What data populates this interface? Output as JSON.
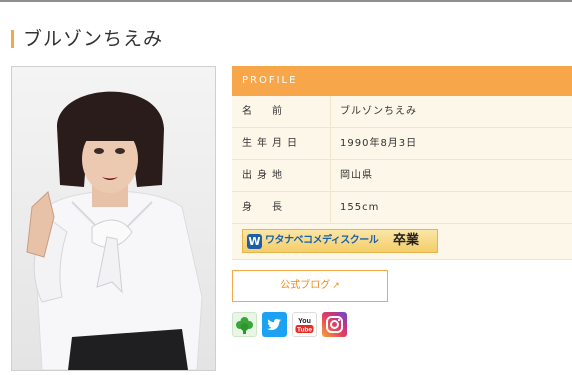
{
  "page": {
    "title": "ブルゾンちえみ"
  },
  "profile": {
    "header": "PROFILE",
    "rows": [
      {
        "label": "名　前",
        "value": "ブルゾンちえみ"
      },
      {
        "label": "生年月日",
        "value": "1990年8月3日"
      },
      {
        "label": "出身地",
        "value": "岡山県"
      },
      {
        "label": "身　長",
        "value": "155cm"
      }
    ],
    "school_badge": {
      "name": "ワタナベコメディスクール",
      "status": "卒業",
      "logo_letter": "W"
    }
  },
  "links": {
    "blog_label": "公式ブログ",
    "blog_icon": "↗"
  },
  "sns": {
    "items": [
      "ameba-icon",
      "twitter-icon",
      "youtube-icon",
      "instagram-icon"
    ],
    "youtube_text": [
      "You",
      "Tube"
    ]
  },
  "colors": {
    "accent": "#f7a649",
    "row_bg": "#fdf7ea",
    "blog_text": "#f08a1b",
    "school_blue": "#1a5fa8"
  }
}
